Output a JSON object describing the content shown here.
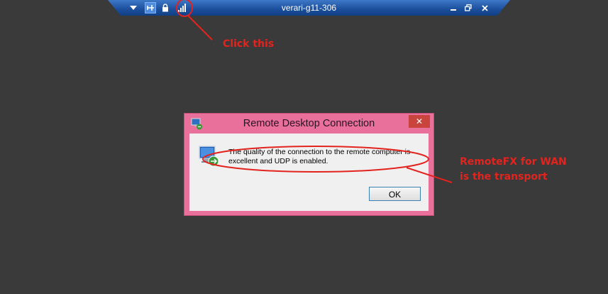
{
  "connection_bar": {
    "title": "verari-g11-306",
    "icons": [
      "chevron-down-icon",
      "pin-icon",
      "lock-icon",
      "signal-bars-icon",
      "minimize-icon",
      "restore-icon",
      "close-icon"
    ]
  },
  "dialog": {
    "title": "Remote Desktop Connection",
    "message": "The quality of the connection to the remote computer is excellent and UDP is enabled.",
    "ok_label": "OK",
    "close_glyph": "✕",
    "title_bar_color": "#e8709a"
  },
  "annotations": {
    "click_this": "Click this",
    "transport_line1": "RemoteFX for WAN",
    "transport_line2": "is the transport",
    "color": "#e3231e"
  }
}
